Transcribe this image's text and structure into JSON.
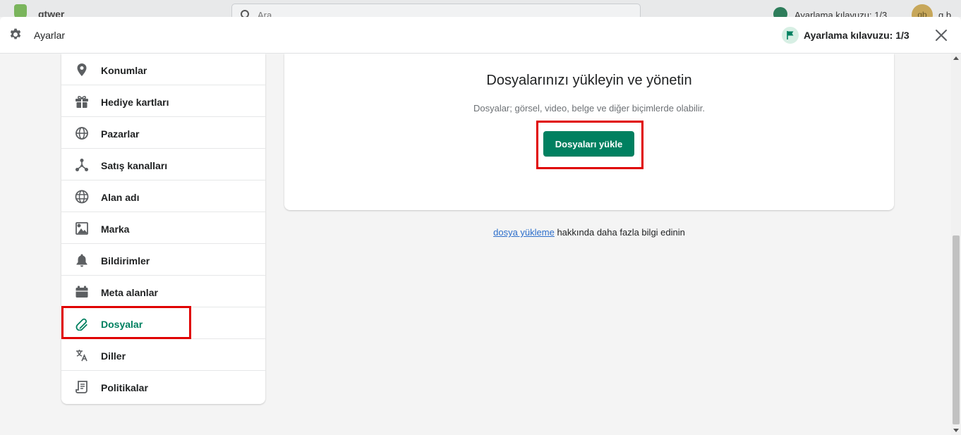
{
  "background_bar": {
    "store_name": "qtwer",
    "search_placeholder": "Ara",
    "guide_text": "Ayarlama kılavuzu: 1/3",
    "avatar_initials": "qb",
    "user_name": "q b"
  },
  "header": {
    "title": "Ayarlar",
    "guide_label": "Ayarlama kılavuzu: 1/3"
  },
  "sidebar": {
    "items": [
      {
        "label": "Konumlar",
        "icon": "location-pin-icon"
      },
      {
        "label": "Hediye kartları",
        "icon": "gift-icon"
      },
      {
        "label": "Pazarlar",
        "icon": "globe-markets-icon"
      },
      {
        "label": "Satış kanalları",
        "icon": "channels-icon"
      },
      {
        "label": "Alan adı",
        "icon": "domain-globe-icon"
      },
      {
        "label": "Marka",
        "icon": "brand-icon"
      },
      {
        "label": "Bildirimler",
        "icon": "bell-icon"
      },
      {
        "label": "Meta alanlar",
        "icon": "metafields-icon"
      },
      {
        "label": "Dosyalar",
        "icon": "paperclip-icon",
        "active": true
      },
      {
        "label": "Diller",
        "icon": "language-icon"
      },
      {
        "label": "Politikalar",
        "icon": "policy-icon"
      }
    ]
  },
  "main": {
    "title": "Dosyalarınızı yükleyin ve yönetin",
    "subtitle": "Dosyalar; görsel, video, belge ve diğer biçimlerde olabilir.",
    "upload_button": "Dosyaları yükle",
    "learn_link": "dosya yükleme",
    "learn_text": " hakkında daha fazla bilgi edinin"
  },
  "colors": {
    "accent": "#008060",
    "highlight": "#e00000",
    "link": "#2c6ecb"
  }
}
